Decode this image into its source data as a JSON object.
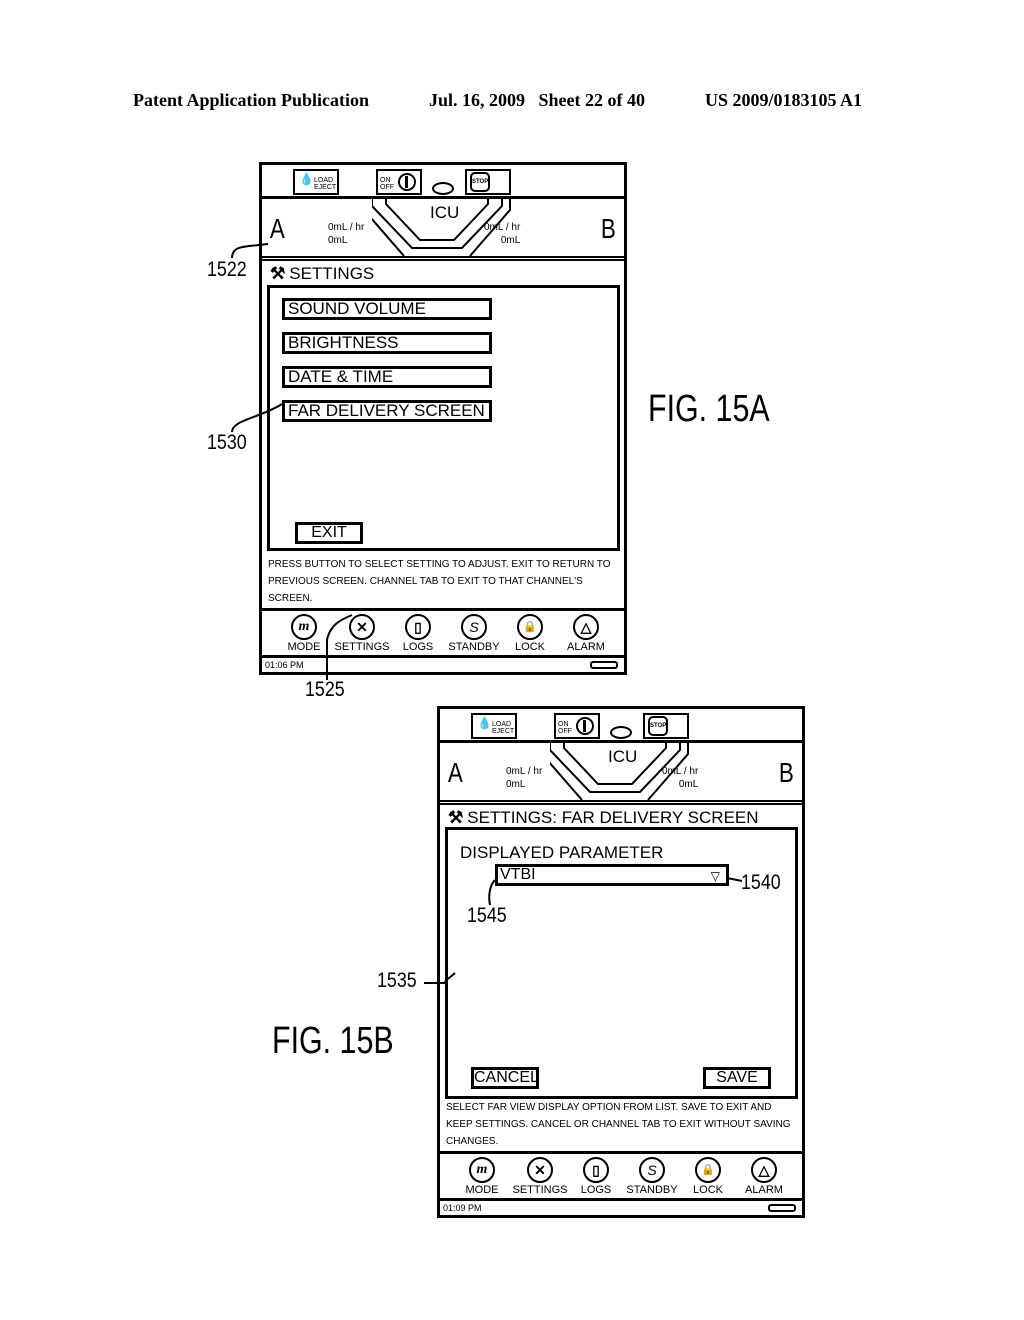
{
  "header": {
    "left": "Patent Application Publication",
    "middle": "Jul. 16, 2009   Sheet 22 of 40",
    "right": "US 2009/0183105 A1"
  },
  "device_common": {
    "load_eject_label": "LOAD EJECT",
    "on_off_label": "ON OFF",
    "stop_label": "STOP",
    "care_area": "ICU",
    "channel_a": {
      "letter": "A",
      "rate": "0mL / hr",
      "volume": "0mL"
    },
    "channel_b": {
      "letter": "B",
      "rate": "0mL / hr",
      "volume": "0mL"
    },
    "nav": [
      {
        "label": "MODE",
        "icon": "mode-icon",
        "glyph": "m"
      },
      {
        "label": "SETTINGS",
        "icon": "tools-icon",
        "glyph": "✕"
      },
      {
        "label": "LOGS",
        "icon": "document-icon",
        "glyph": "▯"
      },
      {
        "label": "STANDBY",
        "icon": "standby-icon",
        "glyph": "S"
      },
      {
        "label": "LOCK",
        "icon": "lock-icon",
        "glyph": "🔒"
      },
      {
        "label": "ALARM",
        "icon": "bell-icon",
        "glyph": "△"
      }
    ]
  },
  "figA": {
    "fig_label": "FIG. 15A",
    "title": "SETTINGS",
    "menu": [
      "SOUND VOLUME",
      "BRIGHTNESS",
      "DATE & TIME",
      "FAR DELIVERY SCREEN"
    ],
    "exit_label": "EXIT",
    "help_text": "PRESS BUTTON TO SELECT SETTING TO ADJUST. EXIT TO RETURN TO PREVIOUS SCREEN. CHANNEL TAB TO EXIT TO THAT CHANNEL'S SCREEN.",
    "time": "01:06 PM",
    "refs": {
      "r1522": "1522",
      "r1530": "1530",
      "r1525": "1525"
    }
  },
  "figB": {
    "fig_label": "FIG. 15B",
    "title": "SETTINGS: FAR DELIVERY SCREEN",
    "param_label": "DISPLAYED PARAMETER",
    "param_value": "VTBI",
    "dropdown_arrow": "▽",
    "cancel_label": "CANCEL",
    "save_label": "SAVE",
    "help_text": "SELECT FAR VIEW DISPLAY OPTION FROM LIST. SAVE TO EXIT AND KEEP SETTINGS. CANCEL OR CHANNEL TAB TO EXIT WITHOUT SAVING CHANGES.",
    "time": "01:09 PM",
    "refs": {
      "r1535": "1535",
      "r1540": "1540",
      "r1545": "1545"
    }
  }
}
